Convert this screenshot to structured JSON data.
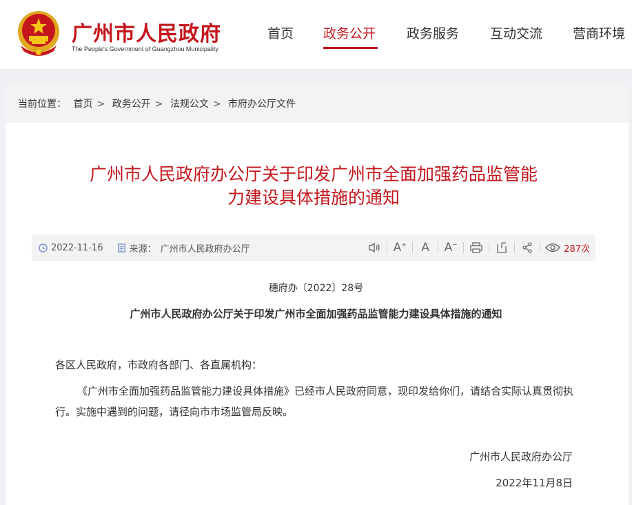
{
  "header": {
    "site_title": "广州市人民政府",
    "site_subtitle": "The People's Government of Guangzhou Municipality",
    "nav": [
      {
        "label": "首页",
        "active": false
      },
      {
        "label": "政务公开",
        "active": true
      },
      {
        "label": "政务服务",
        "active": false
      },
      {
        "label": "互动交流",
        "active": false
      },
      {
        "label": "营商环境",
        "active": false
      }
    ],
    "accent_color": "#c4161c"
  },
  "breadcrumb": {
    "prefix": "当前位置：",
    "items": [
      "首页",
      "政务公开",
      "法规公文",
      "市府办公厅文件"
    ]
  },
  "article": {
    "title_line1": "广州市人民政府办公厅关于印发广州市全面加强药品监管能",
    "title_line2": "力建设具体措施的通知",
    "date": "2022-11-16",
    "source_label": "来源：",
    "source": "广州市人民政府办公厅",
    "views": "287次",
    "doc_number": "穗府办〔2022〕28号",
    "subtitle": "广州市人民政府办公厅关于印发广州市全面加强药品监管能力建设具体措施的通知",
    "salutation": "各区人民政府，市政府各部门、各直属机构：",
    "body": "《广州市全面加强药品监管能力建设具体措施》已经市人民政府同意，现印发给你们，请结合实际认真贯彻执行。实施中遇到的问题，请径向市市场监管局反映。",
    "signature": "广州市人民政府办公厅",
    "sign_date": "2022年11月8日"
  },
  "tools": [
    "speaker-icon",
    "font-increase-icon",
    "font-reset-icon",
    "font-decrease-icon",
    "print-icon",
    "bookmark-icon",
    "share-icon",
    "eye-icon"
  ]
}
